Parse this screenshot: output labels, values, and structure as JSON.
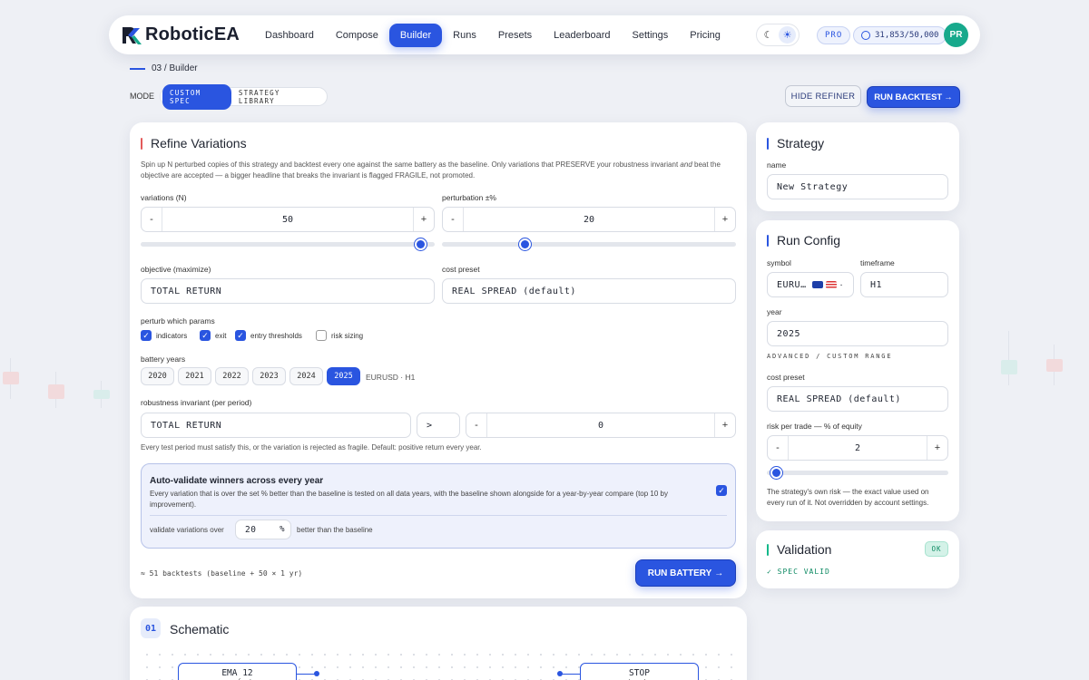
{
  "app": {
    "name": "RoboticEA"
  },
  "nav": {
    "items": [
      {
        "label": "Dashboard"
      },
      {
        "label": "Compose"
      },
      {
        "label": "Builder",
        "active": true
      },
      {
        "label": "Runs"
      },
      {
        "label": "Presets"
      },
      {
        "label": "Leaderboard"
      },
      {
        "label": "Settings"
      },
      {
        "label": "Pricing"
      }
    ],
    "plan_badge": "PRO",
    "credits": "31,853/50,000",
    "avatar_initials": "PR",
    "theme_icons": [
      "moon-icon",
      "sun-icon"
    ]
  },
  "breadcrumb": "03 / Builder",
  "mode": {
    "label": "MODE",
    "options": [
      "CUSTOM SPEC",
      "STRATEGY LIBRARY"
    ],
    "selected": "CUSTOM SPEC"
  },
  "toolbar": {
    "hide_refiner": "HIDE REFINER",
    "run_backtest": "RUN BACKTEST",
    "run_backtest_arrow": "→"
  },
  "refine": {
    "title": "Refine Variations",
    "description_1": "Spin up N perturbed copies of this strategy and backtest every one against the same battery as the baseline. Only variations that PRESERVE your robustness invariant",
    "description_and": "and",
    "description_2": "beat the objective are accepted — a bigger headline that breaks the invariant is flagged FRAGILE, not promoted.",
    "variations_label": "variations (N)",
    "variations_value": "50",
    "variations_slider_fraction": 0.95,
    "perturbation_label": "perturbation ±%",
    "perturbation_value": "20",
    "perturbation_slider_fraction": 0.28,
    "objective_label": "objective (maximize)",
    "objective_value": "TOTAL RETURN",
    "cost_label": "cost preset",
    "cost_value": "REAL SPREAD (default)",
    "perturb_label": "perturb which params",
    "params": [
      {
        "label": "indicators",
        "checked": true
      },
      {
        "label": "exit",
        "checked": true
      },
      {
        "label": "entry thresholds",
        "checked": true
      },
      {
        "label": "risk sizing",
        "checked": false
      }
    ],
    "battery_label": "battery years",
    "years": [
      "2020",
      "2021",
      "2022",
      "2023",
      "2024",
      "2025"
    ],
    "selected_year": "2025",
    "battery_symbol": "EURUSD · H1",
    "invariant_label": "robustness invariant (per period)",
    "invariant_metric": "TOTAL RETURN",
    "invariant_op": ">",
    "invariant_value": "0",
    "invariant_help": "Every test period must satisfy this, or the variation is rejected as fragile. Default: positive return every year.",
    "auto": {
      "title": "Auto-validate winners across every year",
      "desc": "Every variation that is over the set % better than the baseline is tested on all data years, with the baseline shown alongside for a year-by-year compare (top 10 by improvement).",
      "checked": true,
      "prefix": "validate variations over",
      "value": "20",
      "unit": "%",
      "suffix": "better than the baseline"
    },
    "footer_note": "≈ 51 backtests (baseline + 50 × 1 yr)",
    "run_battery": "RUN BATTERY",
    "run_battery_arrow": "→"
  },
  "strategy": {
    "title": "Strategy",
    "name_label": "name",
    "name_value": "New Strategy"
  },
  "run_config": {
    "title": "Run Config",
    "symbol_label": "symbol",
    "symbol_value": "EURU…",
    "timeframe_label": "timeframe",
    "timeframe_value": "H1",
    "year_label": "year",
    "year_value": "2025",
    "advanced_label": "ADVANCED / CUSTOM RANGE",
    "cost_label": "cost preset",
    "cost_value": "REAL SPREAD (default)",
    "risk_label": "risk per trade — % of equity",
    "risk_value": "2",
    "risk_slider_fraction": 0.05,
    "risk_help": "The strategy's own risk — the exact value used on every run of it. Not overridden by account settings."
  },
  "validation": {
    "title": "Validation",
    "badge": "OK",
    "status": "✓ SPEC VALID"
  },
  "schematic": {
    "step": "01",
    "title": "Schematic",
    "nodes": [
      {
        "title": "EMA 12",
        "sub": "ema_fast"
      },
      {
        "title": "STOP",
        "sub": "atr_stop"
      }
    ]
  },
  "colors": {
    "accent": "#2a55e0",
    "avatar": "#17a98c",
    "ok": "#0e8a63",
    "refine_accent": "#e35a5a",
    "strategy_accent": "#2a55e0",
    "validation_accent": "#14b88a"
  }
}
